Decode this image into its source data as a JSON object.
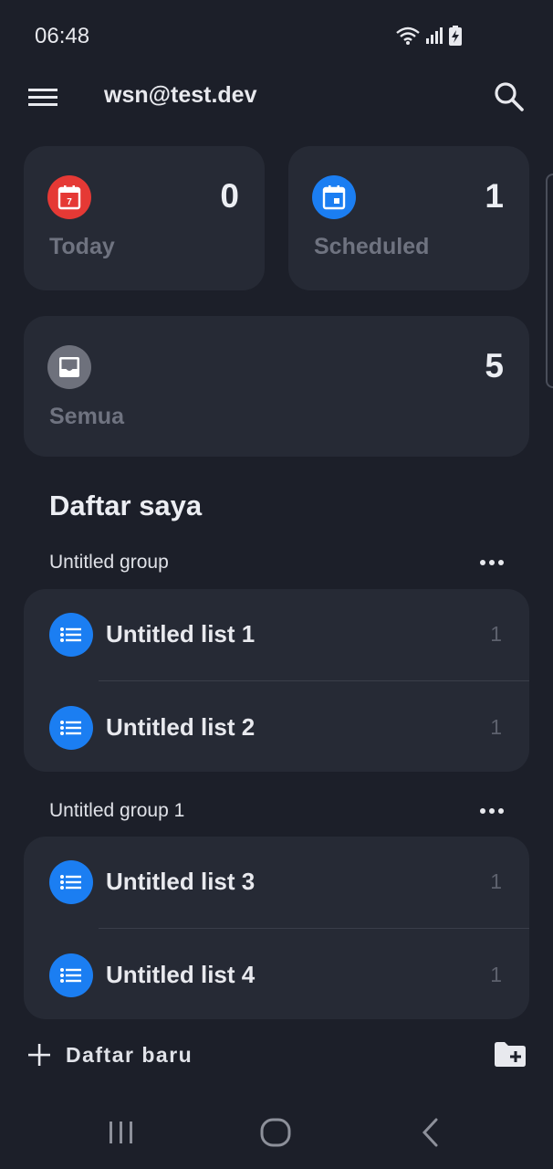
{
  "status": {
    "time": "06:48"
  },
  "header": {
    "account": "wsn@test.dev"
  },
  "smart_lists": {
    "today": {
      "label": "Today",
      "count": "0",
      "calendar_day": "7",
      "color": "#e53935"
    },
    "scheduled": {
      "label": "Scheduled",
      "count": "1",
      "color": "#1b7ef2"
    },
    "all": {
      "label": "Semua",
      "count": "5",
      "color": "#6e717c"
    }
  },
  "section": {
    "title": "Daftar saya"
  },
  "groups": [
    {
      "name": "Untitled group",
      "lists": [
        {
          "name": "Untitled list 1",
          "count": "1"
        },
        {
          "name": "Untitled list 2",
          "count": "1"
        }
      ]
    },
    {
      "name": "Untitled group 1",
      "lists": [
        {
          "name": "Untitled list 3",
          "count": "1"
        },
        {
          "name": "Untitled list 4",
          "count": "1"
        }
      ]
    }
  ],
  "footer": {
    "new_list_label": "Daftar baru"
  },
  "colors": {
    "accent": "#1b7ef2",
    "background": "#1c1f29",
    "card": "#262a35"
  }
}
